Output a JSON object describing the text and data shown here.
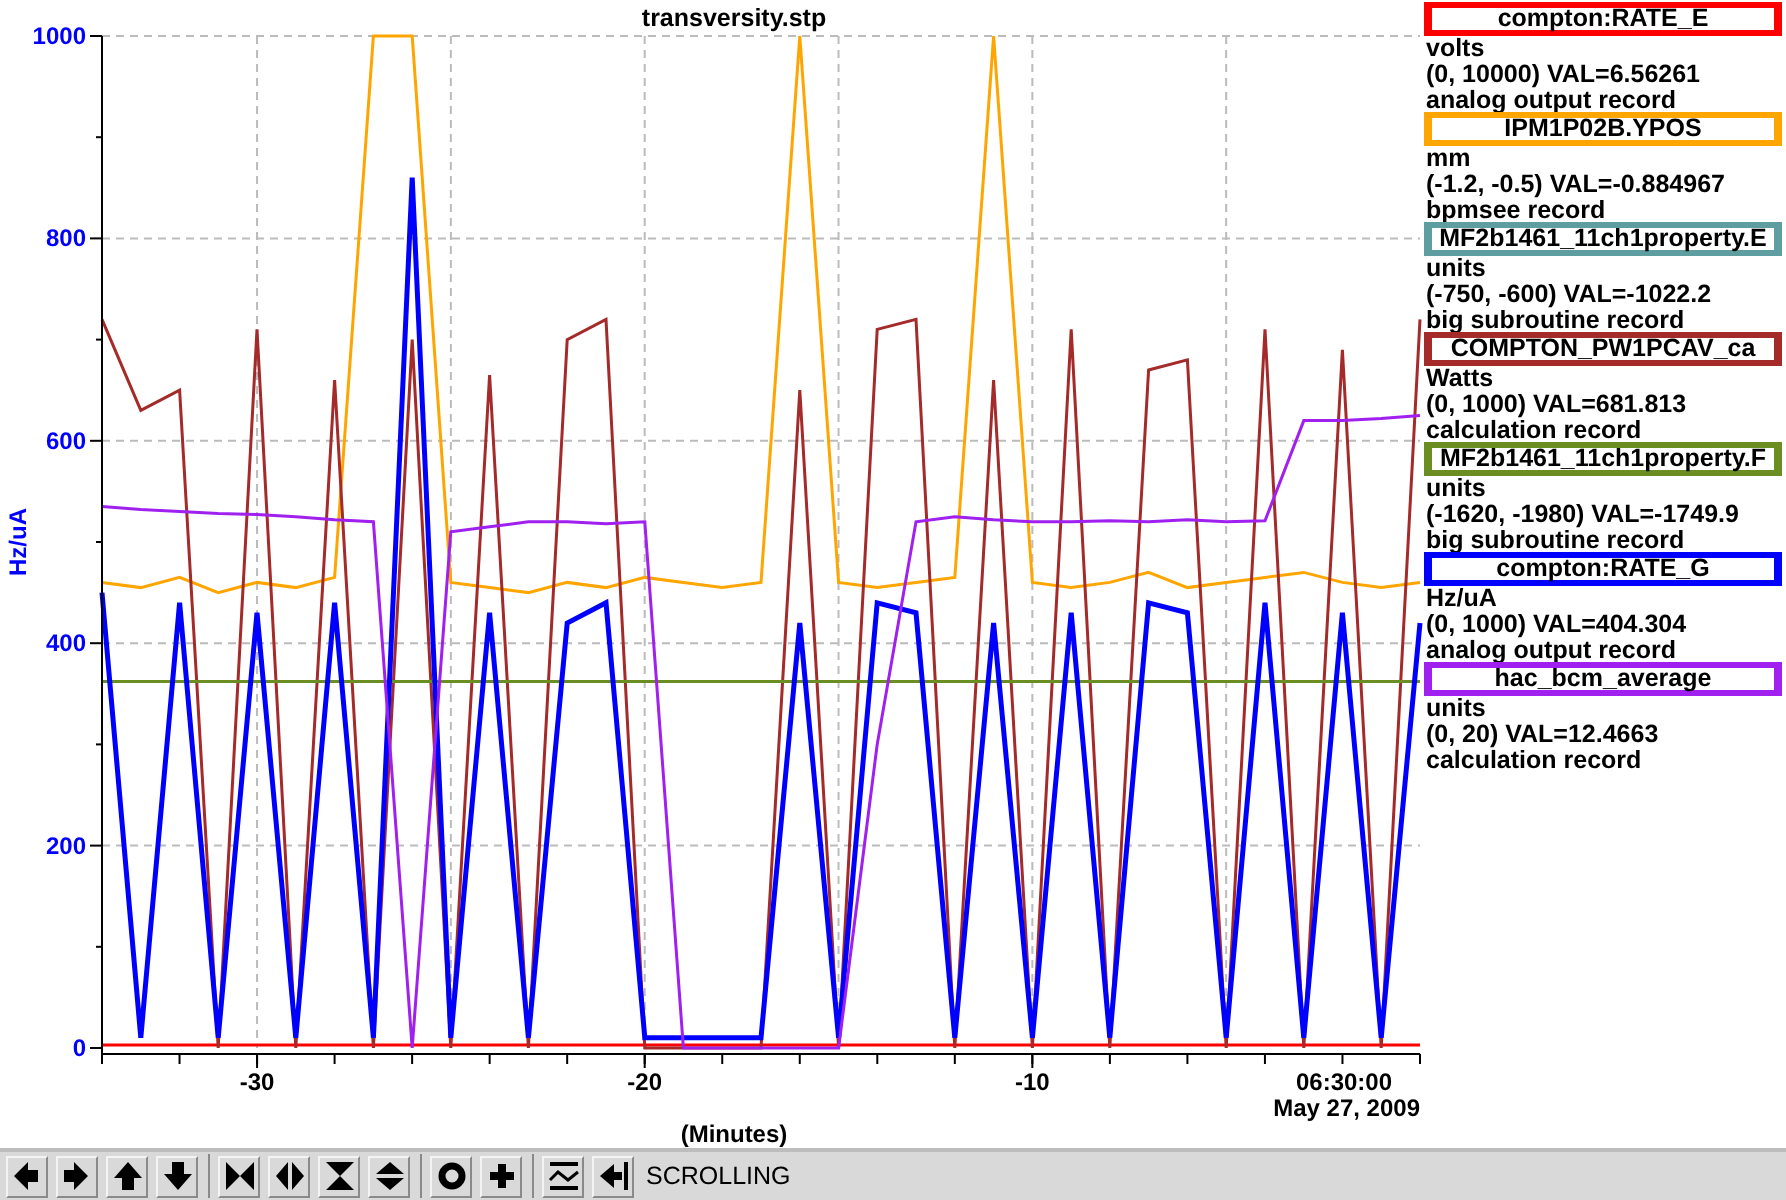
{
  "window": {
    "title": "transversity.stp"
  },
  "plot": {
    "time_label": "06:30:00",
    "date_label": "May 27, 2009",
    "chart_data": {
      "type": "line",
      "grid": true,
      "xlabel": "(Minutes)",
      "ylabel": "Hz/uA",
      "x": [
        -34,
        -33,
        -32,
        -31,
        -30,
        -29,
        -28,
        -27,
        -26,
        -25,
        -24,
        -23,
        -22,
        -21,
        -20,
        -19,
        -18,
        -17,
        -16,
        -15,
        -14,
        -13,
        -12,
        -11,
        -10,
        -9,
        -8,
        -7,
        -6,
        -5,
        -4,
        -3,
        -2,
        -1,
        0
      ],
      "xlim": [
        -34,
        0
      ],
      "ylim": [
        0,
        1000
      ],
      "xticks": [
        -30,
        -20,
        -10
      ],
      "yticks": [
        0,
        200,
        400,
        600,
        800,
        1000
      ],
      "series": [
        {
          "name": "compton:RATE_E",
          "color": "#ff0000",
          "values": [
            3,
            3,
            3,
            3,
            3,
            3,
            3,
            3,
            3,
            3,
            3,
            3,
            3,
            3,
            3,
            3,
            3,
            3,
            3,
            3,
            3,
            3,
            3,
            3,
            3,
            3,
            3,
            3,
            3,
            3,
            3,
            3,
            3,
            3,
            3
          ]
        },
        {
          "name": "IPM1P02B.YPOS",
          "color": "#ffa500",
          "values": [
            460,
            455,
            465,
            450,
            460,
            455,
            465,
            1000,
            1000,
            460,
            455,
            450,
            460,
            455,
            465,
            460,
            455,
            460,
            1000,
            460,
            455,
            460,
            465,
            1000,
            460,
            455,
            460,
            470,
            455,
            460,
            465,
            470,
            460,
            455,
            460
          ]
        },
        {
          "name": "MF2b1461_11ch1property.E",
          "color": "#5f9ea0",
          "values": [
            null,
            null,
            null,
            null,
            null,
            null,
            null,
            null,
            null,
            null,
            null,
            null,
            null,
            null,
            null,
            null,
            null,
            null,
            null,
            null,
            null,
            null,
            null,
            null,
            null,
            null,
            null,
            null,
            null,
            null,
            null,
            null,
            null,
            null,
            null
          ]
        },
        {
          "name": "COMPTON_PW1PCAV_ca",
          "color": "#a52a2a",
          "values": [
            720,
            630,
            650,
            0,
            710,
            0,
            660,
            0,
            700,
            0,
            665,
            0,
            700,
            720,
            0,
            0,
            0,
            0,
            650,
            0,
            710,
            720,
            0,
            660,
            0,
            710,
            0,
            670,
            680,
            0,
            710,
            0,
            690,
            0,
            720
          ]
        },
        {
          "name": "MF2b1461_11ch1property.F",
          "color": "#6b8e23",
          "values": [
            362,
            362,
            362,
            362,
            362,
            362,
            362,
            362,
            362,
            362,
            362,
            362,
            362,
            362,
            362,
            362,
            362,
            362,
            362,
            362,
            362,
            362,
            362,
            362,
            362,
            362,
            362,
            362,
            362,
            362,
            362,
            362,
            362,
            362,
            362
          ]
        },
        {
          "name": "compton:RATE_G",
          "color": "#0000ff",
          "values": [
            450,
            10,
            440,
            10,
            430,
            10,
            440,
            10,
            860,
            10,
            430,
            10,
            420,
            440,
            10,
            10,
            10,
            10,
            420,
            10,
            440,
            430,
            10,
            420,
            10,
            430,
            10,
            440,
            430,
            10,
            440,
            10,
            430,
            10,
            420
          ]
        },
        {
          "name": "hac_bcm_average",
          "color": "#a020f0",
          "values": [
            535,
            532,
            530,
            528,
            527,
            525,
            522,
            520,
            0,
            510,
            515,
            520,
            520,
            518,
            520,
            0,
            0,
            0,
            0,
            0,
            300,
            520,
            525,
            522,
            520,
            520,
            521,
            520,
            522,
            520,
            521,
            620,
            620,
            622,
            625
          ]
        }
      ]
    }
  },
  "legend": [
    {
      "units": "volts",
      "range_value": "(0, 10000) VAL=6.56261",
      "record": "analog output record"
    },
    {
      "units": "mm",
      "range_value": "(-1.2, -0.5) VAL=-0.884967",
      "record": "bpmsee record"
    },
    {
      "units": "units",
      "range_value": "(-750, -600) VAL=-1022.2",
      "record": "big subroutine record"
    },
    {
      "units": "Watts",
      "range_value": "(0, 1000) VAL=681.813",
      "record": "calculation record"
    },
    {
      "units": "units",
      "range_value": "(-1620, -1980) VAL=-1749.9",
      "record": "big subroutine record"
    },
    {
      "units": "Hz/uA",
      "range_value": "(0, 1000) VAL=404.304",
      "record": "analog output record"
    },
    {
      "units": "units",
      "range_value": "(0, 20) VAL=12.4663",
      "record": "calculation record"
    }
  ],
  "toolbar": {
    "groups": [
      [
        {
          "kind": "left"
        },
        {
          "kind": "right"
        },
        {
          "kind": "up"
        },
        {
          "kind": "down"
        }
      ],
      [
        {
          "kind": "zoom-in-x"
        },
        {
          "kind": "zoom-out-x"
        },
        {
          "kind": "zoom-in-y"
        },
        {
          "kind": "zoom-out-y"
        }
      ],
      [
        {
          "kind": "reset"
        },
        {
          "kind": "add"
        }
      ],
      [
        {
          "kind": "graph"
        },
        {
          "kind": "back"
        }
      ]
    ],
    "status": "SCROLLING"
  }
}
